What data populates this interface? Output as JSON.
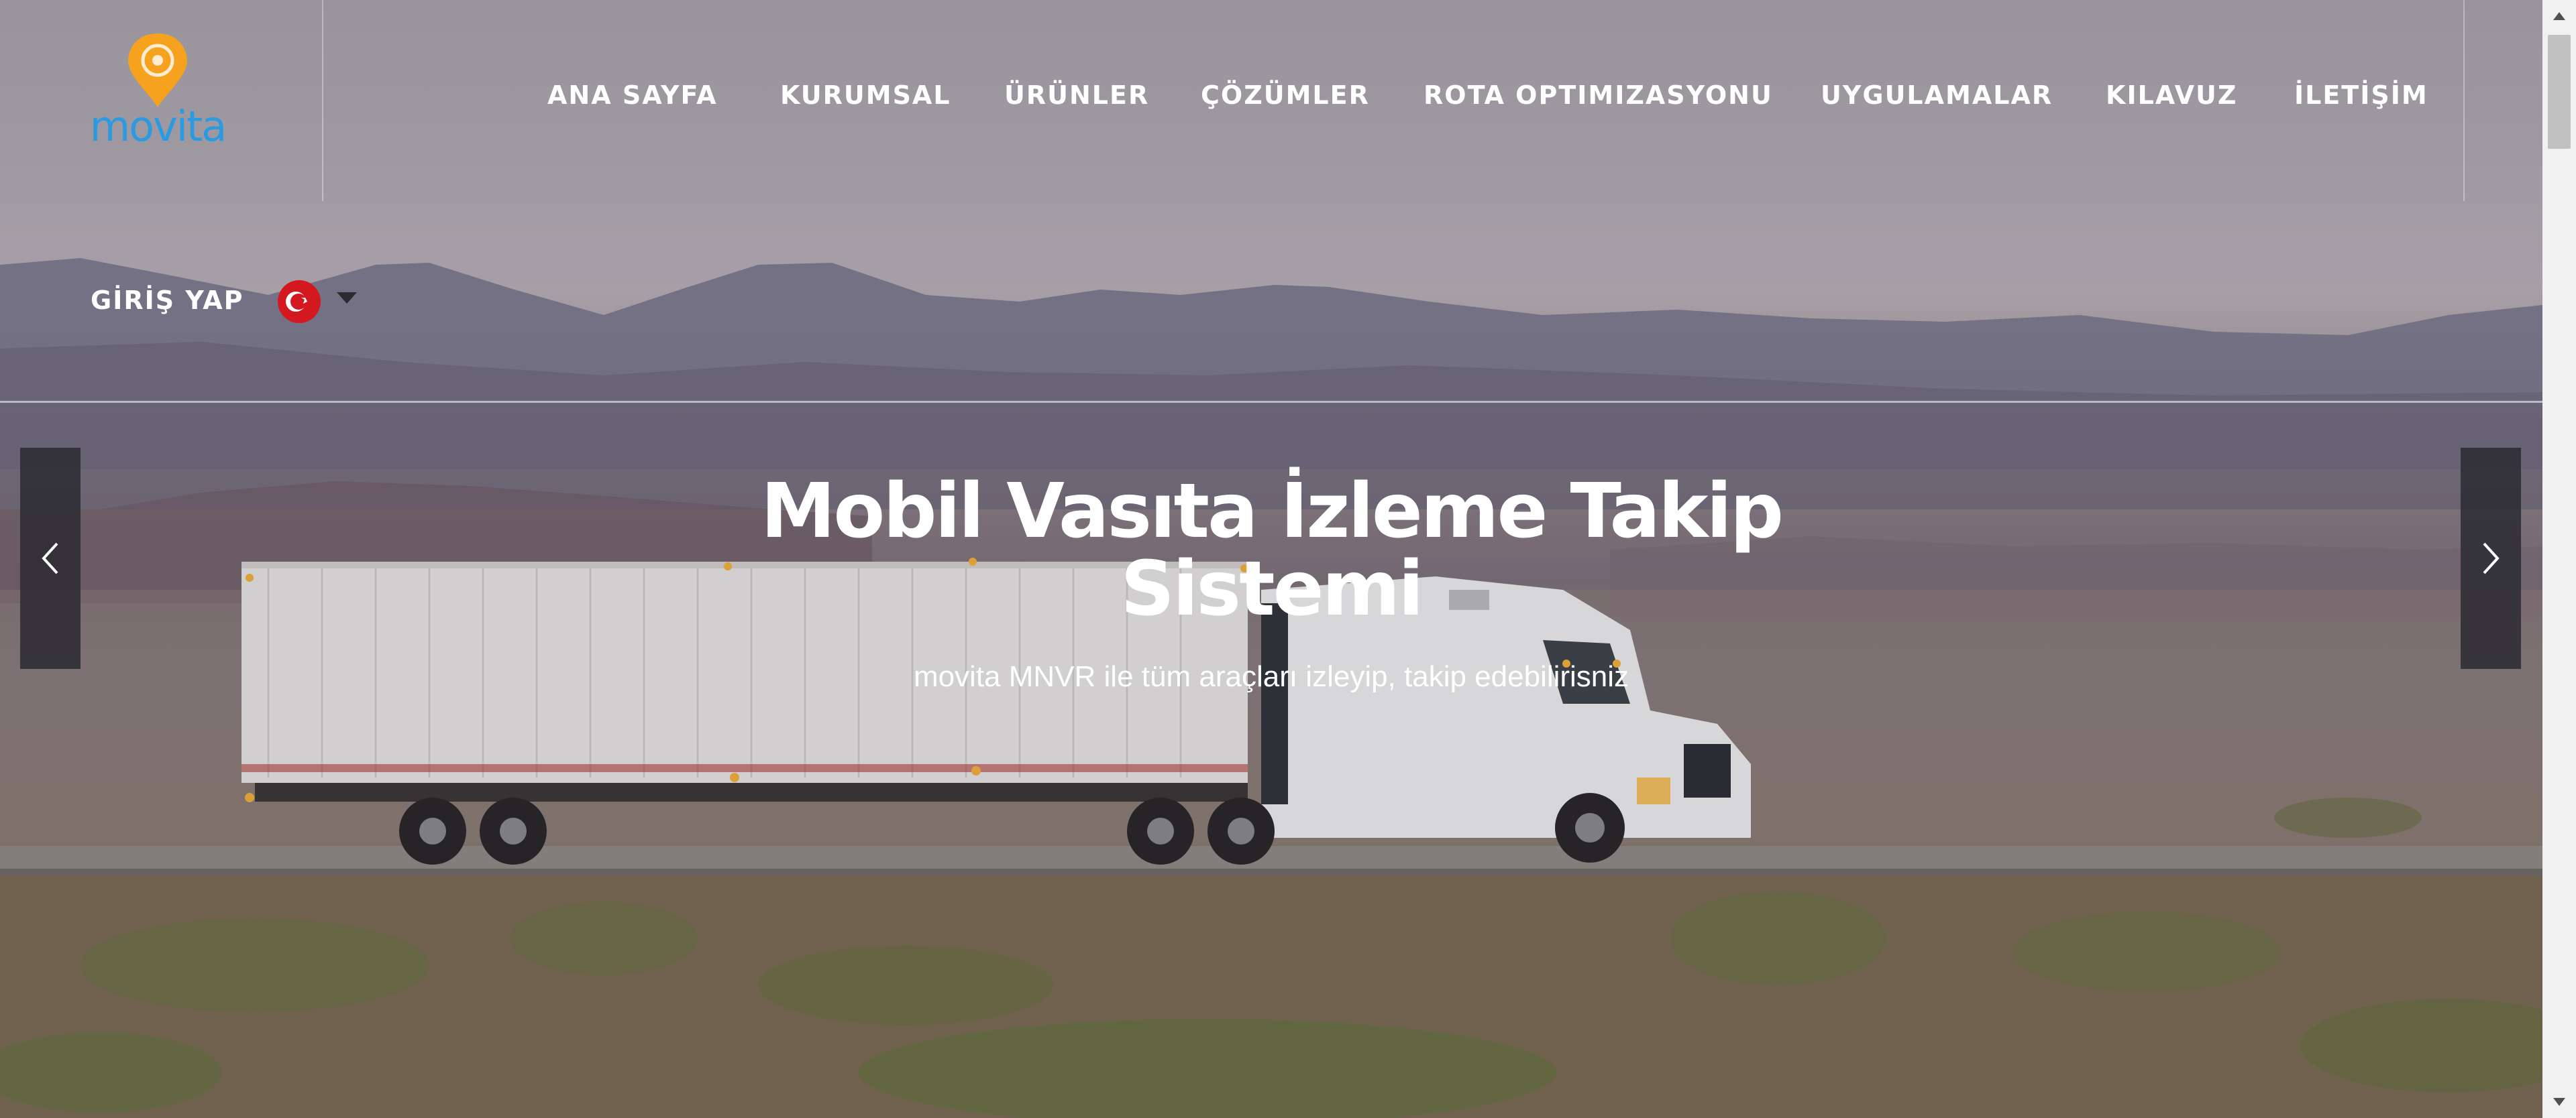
{
  "brand": {
    "logo_text": "movita",
    "logo_color": "#2a9be0",
    "pin_color": "#f6a21e"
  },
  "nav": {
    "items": [
      {
        "label": "ANA SAYFA"
      },
      {
        "label": "KURUMSAL"
      },
      {
        "label": "ÜRÜNLER"
      },
      {
        "label": "ÇÖZÜMLER"
      },
      {
        "label": "ROTA OPTIMIZASYONU"
      },
      {
        "label": "UYGULAMALAR"
      },
      {
        "label": "KILAVUZ"
      },
      {
        "label": "İLETİŞİM"
      }
    ]
  },
  "header": {
    "login_label": "GİRİŞ YAP",
    "language": {
      "selected": "Türkçe",
      "flag_icon": "turkey-flag-icon",
      "flag_color": "#d3191f"
    }
  },
  "hero": {
    "title": "Mobil Vasıta İzleme Takip Sistemi",
    "subtitle": "movita MNVR ile tüm araçları izleyip, takip edebilirisniz",
    "prev_icon": "chevron-left-icon",
    "next_icon": "chevron-right-icon"
  }
}
